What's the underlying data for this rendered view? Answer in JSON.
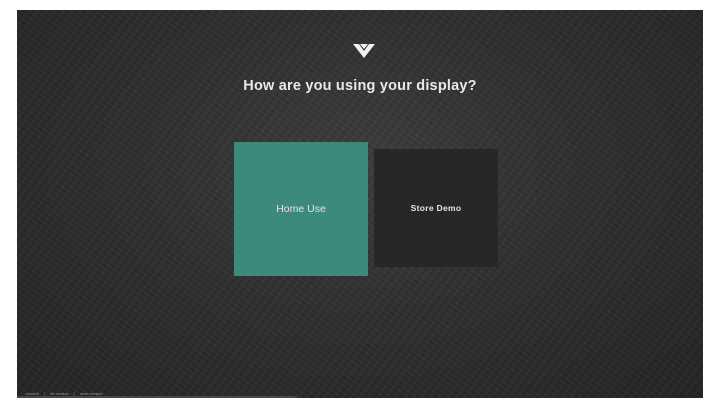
{
  "screen": {
    "logo_icon": "vizio-v-icon",
    "title": "How are you using your display?"
  },
  "options": [
    {
      "label": "Home Use",
      "selected": true
    },
    {
      "label": "Store Demo",
      "selected": false
    }
  ],
  "footer": {
    "items": [
      "vnsdein",
      "rfe version",
      "rsrtw version"
    ],
    "separator": "|"
  },
  "colors": {
    "selected_tile": "#3b8a7c",
    "unselected_tile": "#252729",
    "background": "#2f2f2f"
  }
}
